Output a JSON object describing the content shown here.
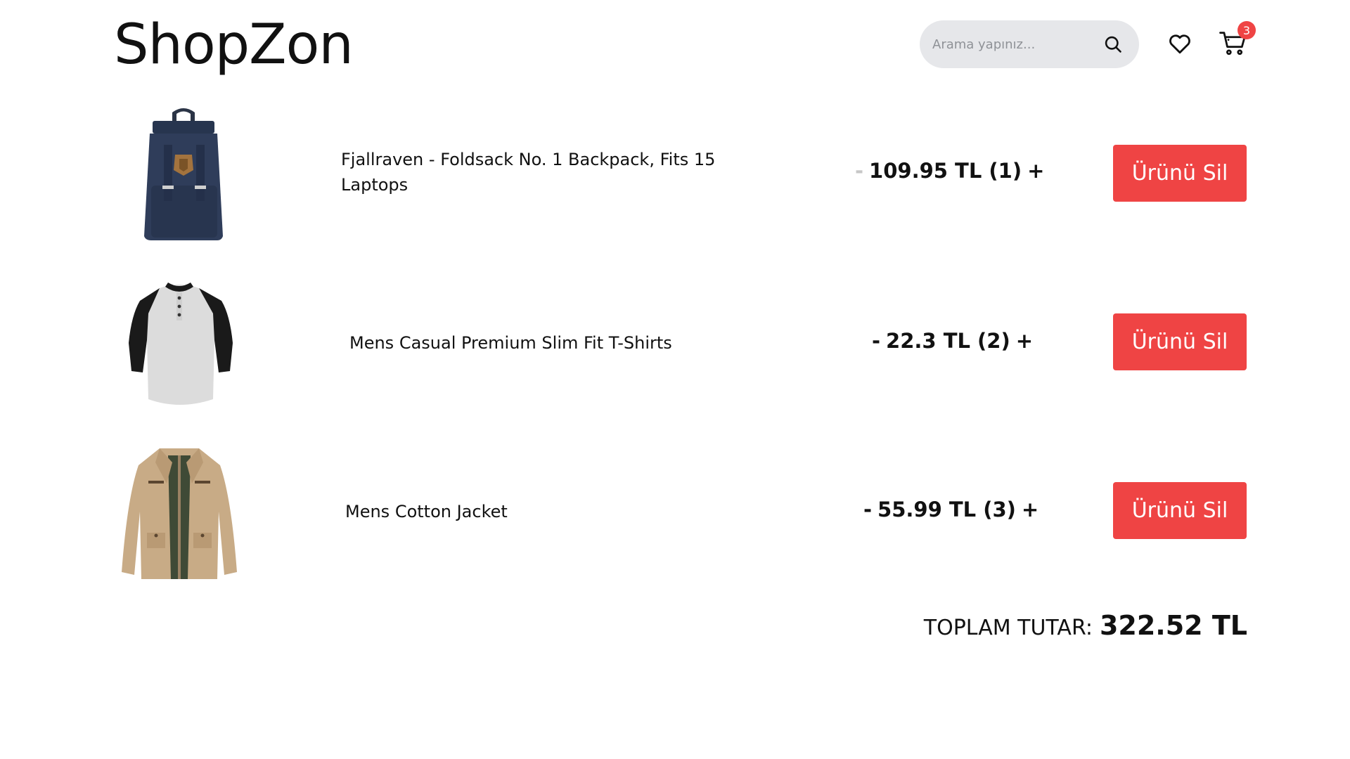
{
  "header": {
    "logo": "ShopZon",
    "search_placeholder": "Arama yapınız...",
    "cart_count": "3"
  },
  "cart": {
    "items": [
      {
        "title_line1": "Fjallraven - Foldsack No. 1 Backpack, Fits 15",
        "title_line2": "Laptops",
        "minus": "-",
        "price_qty": "109.95 TL (1)",
        "plus": "+",
        "delete_label": "Ürünü Sil",
        "image": "backpack"
      },
      {
        "title_line1": "Mens Casual Premium Slim Fit T-Shirts",
        "minus": "-",
        "price_qty": "22.3 TL (2)",
        "plus": "+",
        "delete_label": "Ürünü Sil",
        "image": "t-shirt"
      },
      {
        "title_line1": "Mens Cotton Jacket",
        "minus": "-",
        "price_qty": "55.99 TL (3)",
        "plus": "+",
        "delete_label": "Ürünü Sil",
        "image": "jacket"
      }
    ],
    "total_label": "TOPLAM TUTAR:",
    "total_amount": "322.52 TL"
  },
  "colors": {
    "accent": "#ef4444",
    "search_bg": "#e6e7ea"
  }
}
